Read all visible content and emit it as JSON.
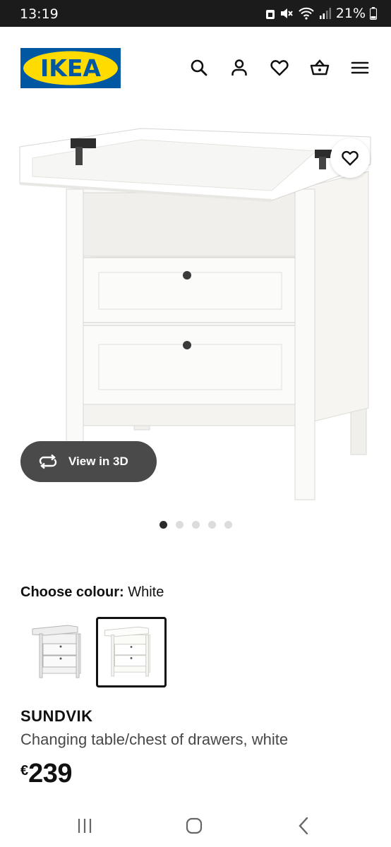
{
  "status_bar": {
    "time": "13:19",
    "battery": "21%"
  },
  "header": {
    "logo_text": "IKEA",
    "brand_blue": "#0058a3",
    "brand_yellow": "#ffdb00",
    "icons": [
      "search-icon",
      "account-icon",
      "heart-icon",
      "basket-icon",
      "menu-icon"
    ]
  },
  "gallery": {
    "view3d_label": "View in 3D",
    "image_count": 5,
    "active_index": 0
  },
  "colour": {
    "label": "Choose colour:",
    "value": "White",
    "options_count": 2,
    "selected_index": 1
  },
  "product": {
    "name": "SUNDVIK",
    "description": "Changing table/chest of drawers, white",
    "currency": "€",
    "price": "239"
  }
}
